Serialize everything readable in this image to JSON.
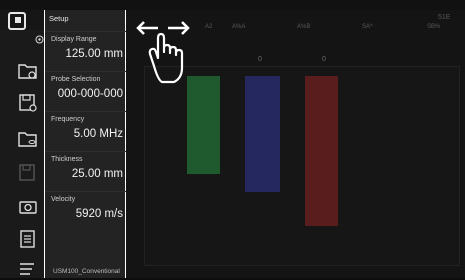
{
  "app": {
    "logo_icon": "app-logo-icon",
    "colors": {
      "background": "#111111",
      "panel": "#232323",
      "text": "#f2f2f2"
    }
  },
  "panel": {
    "title": "Setup",
    "params": [
      {
        "label": "Display Range",
        "value": "125.00 mm"
      },
      {
        "label": "Probe Selection",
        "value": "000-000-000"
      },
      {
        "label": "Frequency",
        "value": "5.00 MHz"
      },
      {
        "label": "Thickness",
        "value": "25.00 mm"
      },
      {
        "label": "Velocity",
        "value": "5920 m/s"
      }
    ],
    "footer": "USM100_Conventional"
  },
  "toolbar": {
    "icons": [
      "folder-settings-icon",
      "save-settings-icon",
      "folder-database-icon",
      "save-disabled-icon",
      "camera-icon",
      "report-icon",
      "menu-icon"
    ]
  },
  "main": {
    "status_right": "51E",
    "header_labels": [
      "A2",
      "A%A",
      "A%B",
      "SA^",
      "SB%"
    ],
    "header_values": [
      "0",
      "0"
    ],
    "gates": [
      {
        "name": "gate-a",
        "color": "#1f5a2e"
      },
      {
        "name": "gate-b",
        "color": "#24285e"
      },
      {
        "name": "gate-c",
        "color": "#5a1d1d"
      }
    ]
  },
  "overlay": {
    "gesture_icon": "swipe-horizontal-hand-icon"
  }
}
